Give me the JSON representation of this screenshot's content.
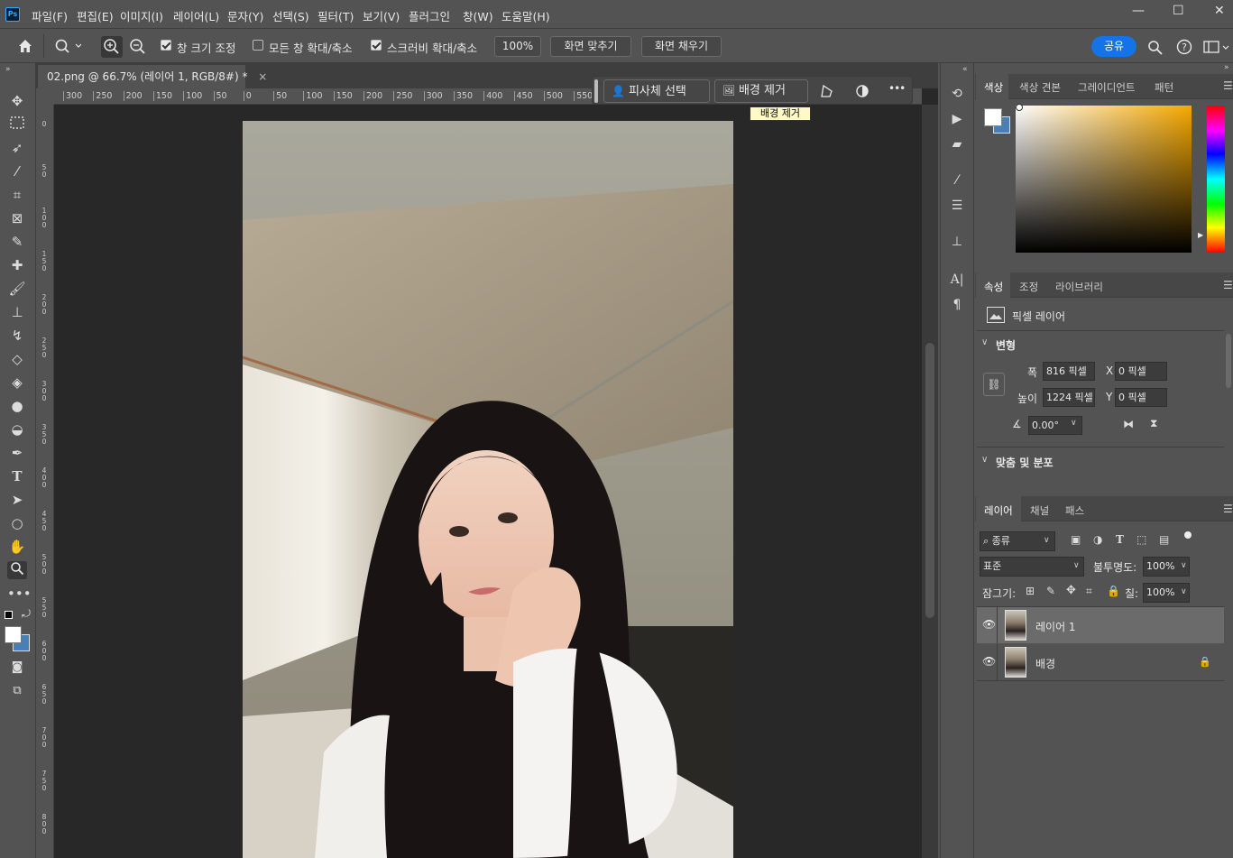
{
  "menubar": {
    "logo": "Ps",
    "items": [
      "파일(F)",
      "편집(E)",
      "이미지(I)",
      "레이어(L)",
      "문자(Y)",
      "선택(S)",
      "필터(T)",
      "보기(V)",
      "플러그인",
      "창(W)",
      "도움말(H)"
    ],
    "minimize": "—",
    "maximize": "☐",
    "close": "✕"
  },
  "options": {
    "resize_windows_label": "창 크기 조정",
    "resize_windows_checked": true,
    "zoom_all_windows_label": "모든 창 확대/축소",
    "zoom_all_windows_checked": false,
    "scrubby_zoom_label": "스크러비 확대/축소",
    "scrubby_zoom_checked": true,
    "zoom_value": "100%",
    "fit_screen_label": "화면 맞추기",
    "fill_screen_label": "화면 채우기",
    "share_label": "공유"
  },
  "document": {
    "tab_title": "02.png @ 66.7% (레이어 1, RGB/8#) *",
    "tab_close": "×"
  },
  "ruler": {
    "h_ticks": [
      "300",
      "250",
      "200",
      "150",
      "100",
      "50",
      "0",
      "50",
      "100",
      "150",
      "200",
      "250",
      "300",
      "350",
      "400",
      "450",
      "500",
      "550",
      "00"
    ],
    "v_ticks": [
      "0",
      "50",
      "100",
      "150",
      "200",
      "250",
      "300",
      "350",
      "400",
      "450",
      "500",
      "550",
      "600",
      "650",
      "700",
      "750",
      "800"
    ]
  },
  "contextual_taskbar": {
    "select_subject_label": "피사체 선택",
    "remove_bg_label": "배경 제거",
    "more": "•••",
    "tooltip": "배경 제거"
  },
  "color_panel": {
    "tabs": [
      "색상",
      "색상 견본",
      "그레이디언트",
      "패턴"
    ],
    "active_tab": "색상",
    "foreground_color": "#ffffff",
    "background_color": "#4a7fb5"
  },
  "properties_panel": {
    "tabs": [
      "속성",
      "조정",
      "라이브러리"
    ],
    "active_tab": "속성",
    "layer_kind": "픽셀 레이어",
    "transform_title": "변형",
    "width_label": "폭",
    "width_value": "816 픽셀",
    "height_label": "높이",
    "height_value": "1224 픽셀",
    "x_label": "X",
    "x_value": "0 픽셀",
    "y_label": "Y",
    "y_value": "0 픽셀",
    "angle_value": "0.00°",
    "align_title": "맞춤 및 분포"
  },
  "layers_panel": {
    "tabs": [
      "레이어",
      "채널",
      "패스"
    ],
    "active_tab": "레이어",
    "filter_kind": "종류",
    "blend_mode": "표준",
    "opacity_label": "불투명도:",
    "opacity_value": "100%",
    "lock_label": "잠그기:",
    "fill_label": "칠:",
    "fill_value": "100%",
    "layers": [
      {
        "name": "레이어 1",
        "selected": true,
        "locked": false
      },
      {
        "name": "배경",
        "selected": false,
        "locked": true
      }
    ]
  }
}
